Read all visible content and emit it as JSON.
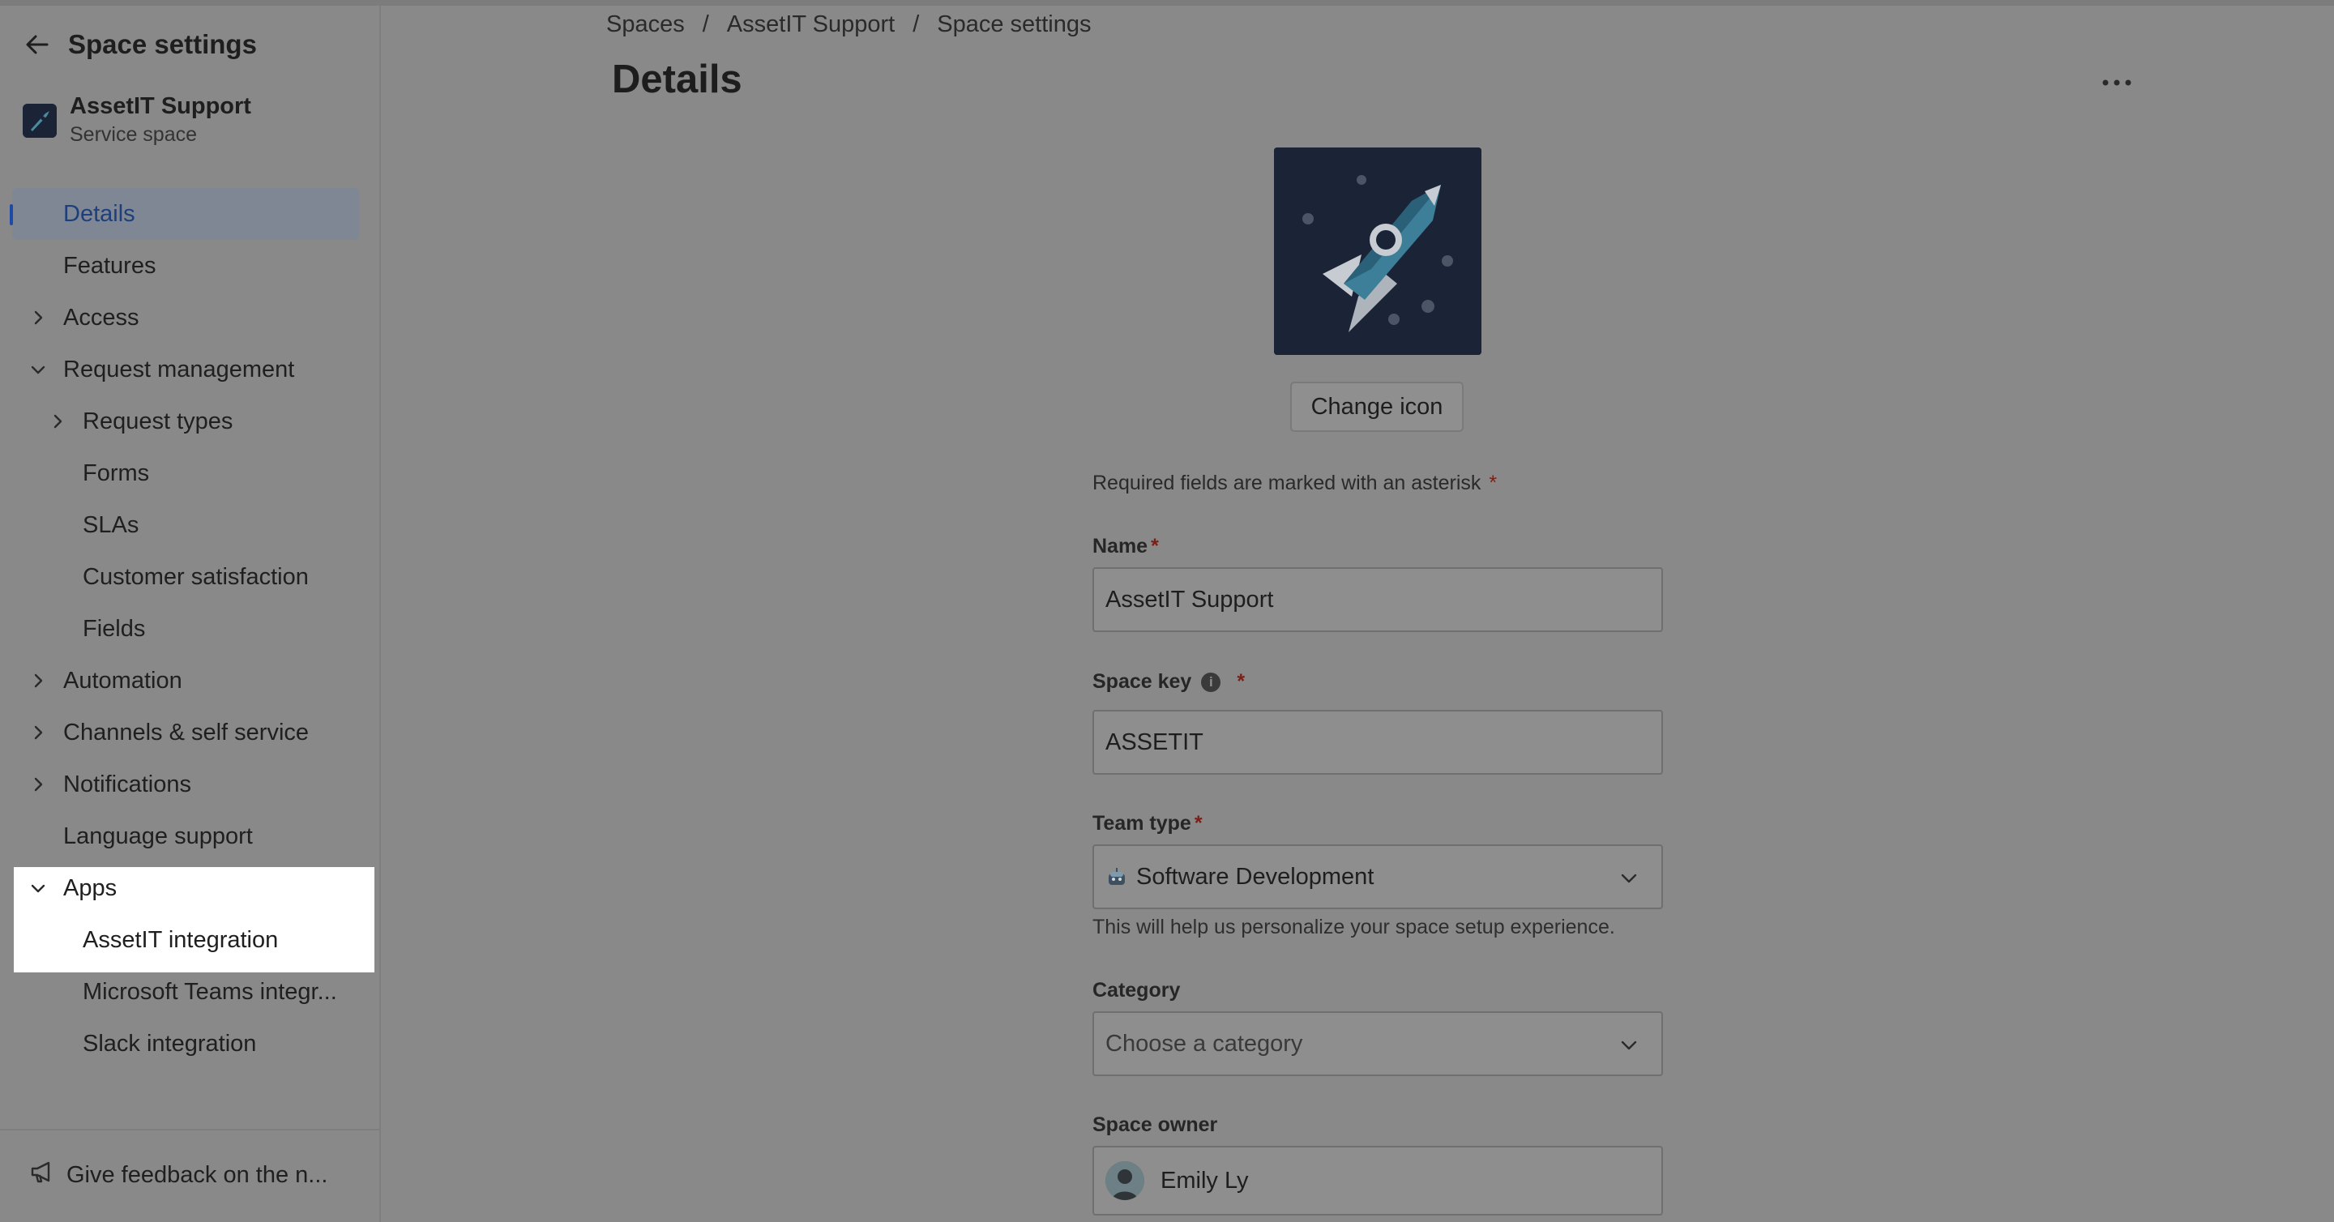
{
  "sidebar": {
    "title": "Space settings",
    "project": {
      "name": "AssetIT Support",
      "type": "Service space"
    },
    "items": [
      {
        "label": "Details"
      },
      {
        "label": "Features"
      },
      {
        "label": "Access"
      },
      {
        "label": "Request management"
      },
      {
        "label": "Request types"
      },
      {
        "label": "Forms"
      },
      {
        "label": "SLAs"
      },
      {
        "label": "Customer satisfaction"
      },
      {
        "label": "Fields"
      },
      {
        "label": "Automation"
      },
      {
        "label": "Channels & self service"
      },
      {
        "label": "Notifications"
      },
      {
        "label": "Language support"
      },
      {
        "label": "Apps"
      },
      {
        "label": "AssetIT integration"
      },
      {
        "label": "Microsoft Teams integr..."
      },
      {
        "label": "Slack integration"
      }
    ],
    "feedback_label": "Give feedback on the n..."
  },
  "breadcrumb": [
    "Spaces",
    "AssetIT Support",
    "Space settings"
  ],
  "page_title": "Details",
  "form": {
    "change_icon_label": "Change icon",
    "required_note": "Required fields are marked with an asterisk",
    "asterisk": "*",
    "name": {
      "label": "Name",
      "value": "AssetIT Support"
    },
    "space_key": {
      "label": "Space key",
      "value": "ASSETIT"
    },
    "team_type": {
      "label": "Team type",
      "value": "Software Development",
      "helper": "This will help us personalize your space setup experience."
    },
    "category": {
      "label": "Category",
      "placeholder": "Choose a category"
    },
    "space_owner": {
      "label": "Space owner",
      "value": "Emily Ly"
    }
  }
}
